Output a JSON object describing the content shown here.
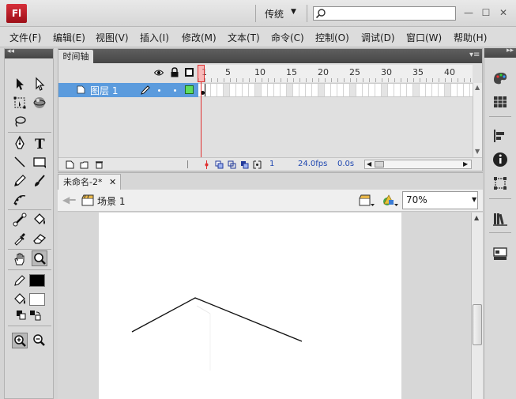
{
  "titlebar": {
    "logo": "Fl",
    "workspace": "传统",
    "search_placeholder": ""
  },
  "menu": [
    {
      "id": "file",
      "label": "文件(F)"
    },
    {
      "id": "edit",
      "label": "编辑(E)"
    },
    {
      "id": "view",
      "label": "视图(V)"
    },
    {
      "id": "insert",
      "label": "插入(I)"
    },
    {
      "id": "modify",
      "label": "修改(M)"
    },
    {
      "id": "text",
      "label": "文本(T)"
    },
    {
      "id": "commands",
      "label": "命令(C)"
    },
    {
      "id": "control",
      "label": "控制(O)"
    },
    {
      "id": "debug",
      "label": "调试(D)"
    },
    {
      "id": "window",
      "label": "窗口(W)"
    },
    {
      "id": "help",
      "label": "帮助(H)"
    }
  ],
  "timeline": {
    "tab_label": "时间轴",
    "layer_name": "图层 1",
    "layer_color": "#5fdc5f",
    "ruler": [
      "1",
      "5",
      "10",
      "15",
      "20",
      "25",
      "30",
      "35",
      "40"
    ],
    "current_frame": "1",
    "fps": "24.0fps",
    "time": "0.0s"
  },
  "document": {
    "tab_label": "未命名-2*",
    "close_glyph": "✕",
    "scene_label": "场景 1",
    "zoom": "70%"
  },
  "colors": {
    "layer_selected": "#5b9bdd",
    "playhead": "#e03030",
    "stroke_color": "#000000",
    "fill_color": "#ffffff"
  }
}
